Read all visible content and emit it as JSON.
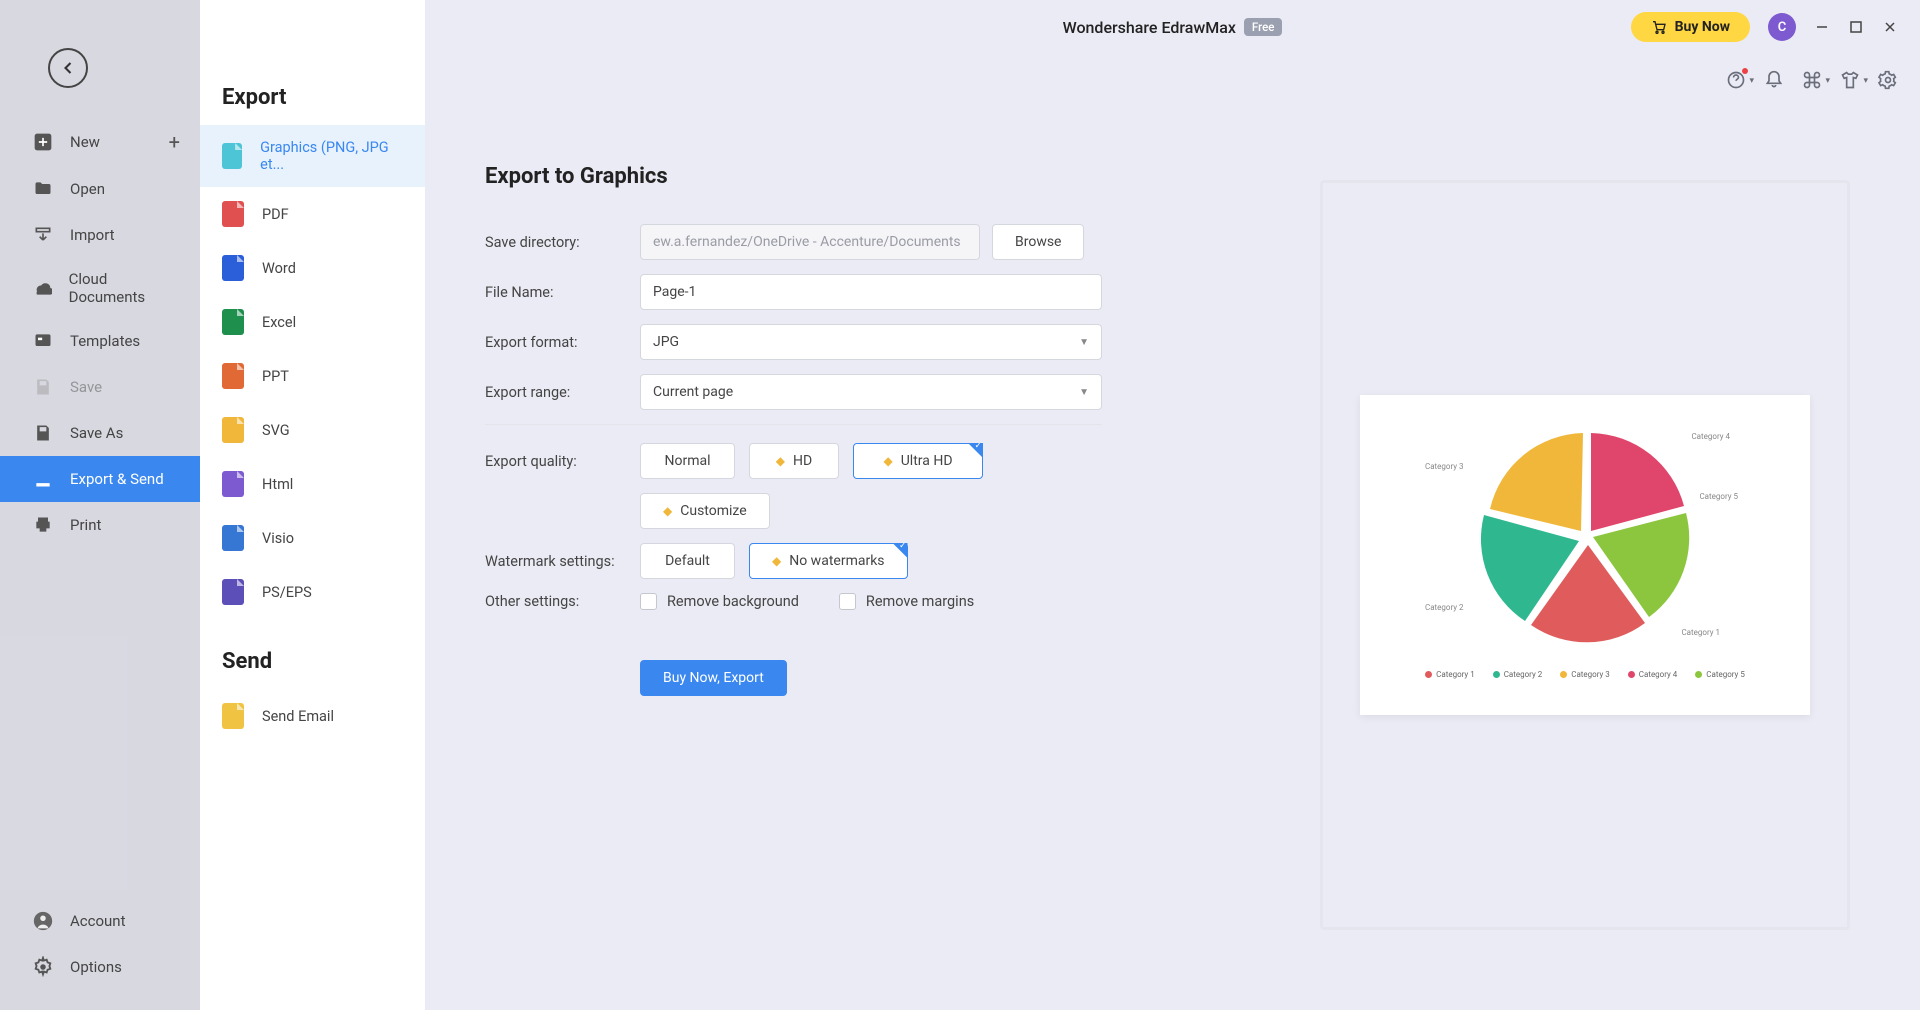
{
  "app": {
    "name": "Wondershare EdrawMax",
    "badge": "Free",
    "buy_now": "Buy Now",
    "avatar_initial": "C"
  },
  "nav": {
    "new": "New",
    "open": "Open",
    "import": "Import",
    "cloud": "Cloud Documents",
    "templates": "Templates",
    "save": "Save",
    "save_as": "Save As",
    "export_send": "Export & Send",
    "print": "Print",
    "account": "Account",
    "options": "Options"
  },
  "sub": {
    "export_heading": "Export",
    "send_heading": "Send",
    "graphics": "Graphics (PNG, JPG et...",
    "pdf": "PDF",
    "word": "Word",
    "excel": "Excel",
    "ppt": "PPT",
    "svg": "SVG",
    "html": "Html",
    "visio": "Visio",
    "pseps": "PS/EPS",
    "send_email": "Send Email"
  },
  "form": {
    "title": "Export to Graphics",
    "save_dir_label": "Save directory:",
    "save_dir_value": "ew.a.fernandez/OneDrive - Accenture/Documents",
    "browse": "Browse",
    "file_name_label": "File Name:",
    "file_name_value": "Page-1",
    "format_label": "Export format:",
    "format_value": "JPG",
    "range_label": "Export range:",
    "range_value": "Current page",
    "quality_label": "Export quality:",
    "qual_normal": "Normal",
    "qual_hd": "HD",
    "qual_uhd": "Ultra HD",
    "qual_customize": "Customize",
    "watermark_label": "Watermark settings:",
    "wm_default": "Default",
    "wm_none": "No watermarks",
    "other_label": "Other settings:",
    "remove_bg": "Remove background",
    "remove_margins": "Remove margins",
    "buy_export": "Buy Now, Export"
  },
  "chart_data": {
    "type": "pie",
    "title": "",
    "series": [
      {
        "name": "Category 1",
        "value": 20,
        "color": "#e05c5c"
      },
      {
        "name": "Category 2",
        "value": 20,
        "color": "#2fb890"
      },
      {
        "name": "Category 3",
        "value": 20,
        "color": "#f0b73a"
      },
      {
        "name": "Category 4",
        "value": 20,
        "color": "#e0466b"
      },
      {
        "name": "Category 5",
        "value": 20,
        "color": "#8cc63f"
      }
    ],
    "labels": [
      "Category 1",
      "Category 2",
      "Category 3",
      "Category 4",
      "Category 5"
    ]
  }
}
